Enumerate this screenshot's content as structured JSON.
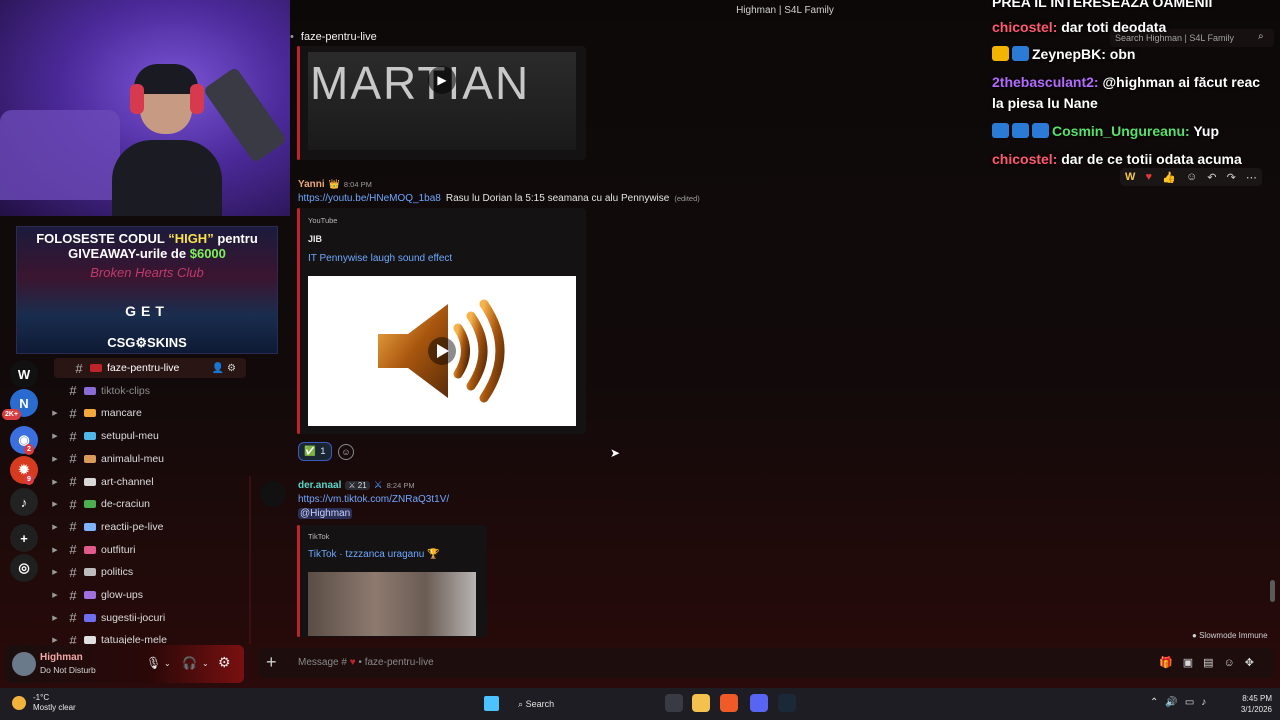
{
  "window": {
    "title": "Highman | S4L Family"
  },
  "channel_header": {
    "name": "faze-pentru-live",
    "search_placeholder": "Search Highman | S4L Family"
  },
  "overlay_ad": {
    "line1_prefix": "FOLOSESTE CODUL",
    "code": "“HIGH”",
    "line1_suffix": "pentru",
    "line2_prefix": "GIVEAWAY-urile de",
    "amount": "$6000",
    "tagline": "Broken Hearts Club",
    "get": "GET",
    "brand": "CSG⚙SKINS"
  },
  "servers": [
    {
      "icon": "w-icon",
      "glyph": "W",
      "color": "#111111",
      "badge": ""
    },
    {
      "icon": "server-2k-icon",
      "glyph": "N",
      "color": "#2a6bd0",
      "badge": "2K+"
    },
    {
      "icon": "server-ring-icon",
      "glyph": "◉",
      "color": "#3b6fe0",
      "badge": "2"
    },
    {
      "icon": "server-fire-icon",
      "glyph": "✹",
      "color": "#d63b1f",
      "badge": "9"
    },
    {
      "icon": "server-music-icon",
      "glyph": "♪",
      "color": "#222222",
      "badge": ""
    },
    {
      "icon": "add-server-icon",
      "glyph": "+",
      "color": "#1f1f1f",
      "badge": ""
    },
    {
      "icon": "discover-icon",
      "glyph": "◎",
      "color": "#1f1f1f",
      "badge": ""
    }
  ],
  "channels": [
    {
      "name": "faze-pentru-live",
      "emoji_color": "#c0242a",
      "active": true,
      "muted": false
    },
    {
      "name": "tiktok-clips",
      "emoji_color": "#8b6bd6",
      "active": false,
      "muted": true
    },
    {
      "name": "mancare",
      "emoji_color": "#f2a83b",
      "active": false,
      "muted": false
    },
    {
      "name": "setupul-meu",
      "emoji_color": "#4fb8e8",
      "active": false,
      "muted": false
    },
    {
      "name": "animalul-meu",
      "emoji_color": "#d99a5a",
      "active": false,
      "muted": false
    },
    {
      "name": "art-channel",
      "emoji_color": "#d8d8d8",
      "active": false,
      "muted": false
    },
    {
      "name": "de-craciun",
      "emoji_color": "#4caf50",
      "active": false,
      "muted": false
    },
    {
      "name": "reactii-pe-live",
      "emoji_color": "#7fb3ff",
      "active": false,
      "muted": false
    },
    {
      "name": "outfituri",
      "emoji_color": "#e05a8a",
      "active": false,
      "muted": false
    },
    {
      "name": "politics",
      "emoji_color": "#bcbcbc",
      "active": false,
      "muted": false
    },
    {
      "name": "glow-ups",
      "emoji_color": "#a070e0",
      "active": false,
      "muted": false
    },
    {
      "name": "sugestii-jocuri",
      "emoji_color": "#6e6ef0",
      "active": false,
      "muted": false
    },
    {
      "name": "tatuajele-mele",
      "emoji_color": "#e0e0e0",
      "active": false,
      "muted": false
    }
  ],
  "user_panel": {
    "name": "Highman",
    "status": "Do Not Disturb"
  },
  "messages": {
    "top_embed": {
      "title_text": "MARTIAN"
    },
    "yanni": {
      "author": "Yanni",
      "time": "8:04 PM",
      "link": "https://youtu.be/HNeMOQ_1ba8",
      "text": "Rasu lu Dorian la 5:15 seamana cu alu Pennywise",
      "edited": "(edited)",
      "embed_provider": "YouTube",
      "embed_author": "JIB",
      "embed_title": "IT Pennywise laugh sound effect",
      "reaction_emoji": "✅",
      "reaction_count": "1"
    },
    "der": {
      "author": "der.anaal",
      "level": "21",
      "time": "8:24 PM",
      "link": "https://vm.tiktok.com/ZNRaQ3t1V/",
      "mention": "@Highman",
      "embed_provider": "TikTok",
      "embed_title": "TikTok · tzzzanca uraganu 🏆"
    }
  },
  "composer": {
    "placeholder_prefix": "Message #",
    "placeholder_channel": "faze-pentru-live"
  },
  "slowmode": "Slowmode Immune",
  "twitch_chat": [
    {
      "user": "",
      "user_color": "#ffffff",
      "text": "PREA IL INTERESEAZA OAMENII",
      "badges": []
    },
    {
      "user": "chicostel:",
      "user_color": "#ff5a6e",
      "text": "dar toti deodata",
      "badges": []
    },
    {
      "user": "ZeynepBK:",
      "user_color": "#ffffff",
      "text": "obn",
      "badges": [
        "#f2b400",
        "#2b7bd6"
      ]
    },
    {
      "user": "2thebasculant2:",
      "user_color": "#b36bff",
      "text": "@highman ai făcut reac la piesa lu Nane",
      "badges": []
    },
    {
      "user": "Cosmin_Ungureanu:",
      "user_color": "#58e06a",
      "text": "Yup",
      "badges": [
        "#2b7bd6",
        "#2b7bd6",
        "#2b7bd6"
      ]
    },
    {
      "user": "chicostel:",
      "user_color": "#ff5a6e",
      "text": "dar de ce totii odata acuma",
      "badges": []
    }
  ],
  "taskbar": {
    "temperature": "-1°C",
    "weather": "Mostly clear",
    "search": "Search",
    "time": "8:45 PM",
    "date": "3/1/2026"
  }
}
